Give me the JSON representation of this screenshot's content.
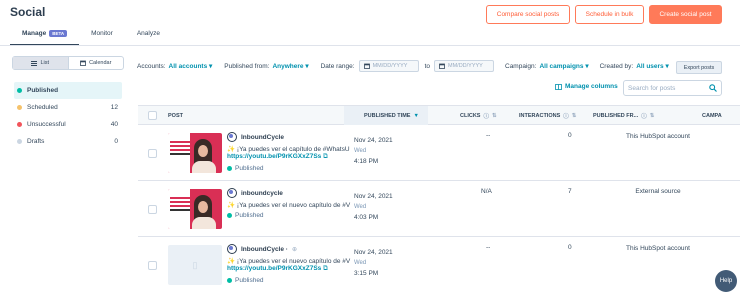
{
  "header": {
    "title": "Social",
    "compare_label": "Compare social posts",
    "schedule_bulk_label": "Schedule in bulk",
    "create_label": "Create social post"
  },
  "tabs": [
    {
      "label": "Manage",
      "badge": "BETA"
    },
    {
      "label": "Monitor"
    },
    {
      "label": "Analyze"
    }
  ],
  "view_toggle": {
    "list_label": "List",
    "calendar_label": "Calendar"
  },
  "filters": {
    "accounts_label": "Accounts:",
    "accounts_value": "All accounts",
    "published_from_label": "Published from:",
    "published_from_value": "Anywhere",
    "date_range_label": "Date range:",
    "date_placeholder_start": "MM/DD/YYYY",
    "to_label": "to",
    "date_placeholder_end": "MM/DD/YYYY",
    "campaign_label": "Campaign:",
    "campaign_value": "All campaigns",
    "created_by_label": "Created by:",
    "created_by_value": "All users",
    "export_label": "Export posts"
  },
  "sidebar": {
    "items": [
      {
        "label": "Published",
        "count": "",
        "color": "#00bda5"
      },
      {
        "label": "Scheduled",
        "count": "12",
        "color": "#f5c26b"
      },
      {
        "label": "Unsuccessful",
        "count": "40",
        "color": "#f2545b"
      },
      {
        "label": "Drafts",
        "count": "0",
        "color": "#cbd6e2"
      }
    ]
  },
  "toolbar": {
    "manage_columns_label": "Manage columns",
    "search_placeholder": "Search for posts"
  },
  "table": {
    "columns": {
      "post": "POST",
      "published_time": "PUBLISHED TIME",
      "clicks": "CLICKS",
      "interactions": "INTERACTIONS",
      "published_from": "PUBLISHED FR...",
      "campaign": "CAMPA"
    },
    "rows": [
      {
        "account": "InboundCycle",
        "text": "¡Ya puedes ver el capítulo de #WhatsU",
        "link": "https://youtu.be/P9rKGXxZ7Ss",
        "status": "Published",
        "date": "Nov 24, 2021",
        "weekday": "Wed",
        "time": "4:18 PM",
        "clicks": "--",
        "interactions": "0",
        "published_from": "This HubSpot account"
      },
      {
        "account": "inboundcycle",
        "text": "¡Ya puedes ver el nuevo capítulo de #V",
        "link": "",
        "status": "Published",
        "date": "Nov 24, 2021",
        "weekday": "Wed",
        "time": "4:03 PM",
        "clicks": "N/A",
        "interactions": "7",
        "published_from": "External source"
      },
      {
        "account": "InboundCycle ·",
        "text": "¡Ya puedes ver el nuevo capítulo de #V",
        "link": "https://youtu.be/P9rKGXxZ7Ss",
        "status": "Published",
        "date": "Nov 24, 2021",
        "weekday": "Wed",
        "time": "3:15 PM",
        "clicks": "--",
        "interactions": "0",
        "published_from": "This HubSpot account"
      }
    ]
  },
  "help_label": "Help"
}
